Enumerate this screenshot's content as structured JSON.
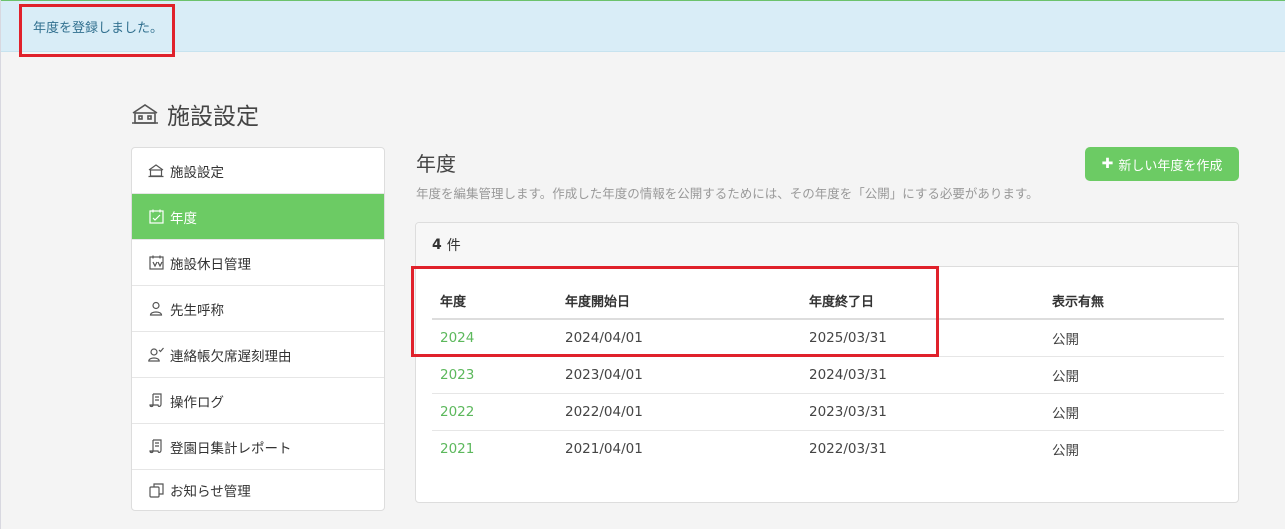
{
  "alert": {
    "message": "年度を登録しました。"
  },
  "page": {
    "title": "施設設定"
  },
  "sidebar": {
    "items": [
      {
        "label": "施設設定",
        "icon": "building-icon",
        "active": false
      },
      {
        "label": "年度",
        "icon": "calendar-icon",
        "active": true
      },
      {
        "label": "施設休日管理",
        "icon": "calendar-icon",
        "active": false
      },
      {
        "label": "先生呼称",
        "icon": "person-icon",
        "active": false
      },
      {
        "label": "連絡帳欠席遅刻理由",
        "icon": "person-check-icon",
        "active": false
      },
      {
        "label": "操作ログ",
        "icon": "scroll-icon",
        "active": false
      },
      {
        "label": "登園日集計レポート",
        "icon": "scroll-icon",
        "active": false
      },
      {
        "label": "お知らせ管理",
        "icon": "copy-icon",
        "active": false
      }
    ]
  },
  "section": {
    "title": "年度",
    "description": "年度を編集管理します。作成した年度の情報を公開するためには、その年度を「公開」にする必要があります。",
    "new_button_label": "新しい年度を作成"
  },
  "panel": {
    "count": "4",
    "count_suffix": "件"
  },
  "table": {
    "columns": [
      "年度",
      "年度開始日",
      "年度終了日",
      "表示有無"
    ],
    "rows": [
      {
        "year": "2024",
        "start": "2024/04/01",
        "end": "2025/03/31",
        "visibility": "公開"
      },
      {
        "year": "2023",
        "start": "2023/04/01",
        "end": "2024/03/31",
        "visibility": "公開"
      },
      {
        "year": "2022",
        "start": "2022/04/01",
        "end": "2023/03/31",
        "visibility": "公開"
      },
      {
        "year": "2021",
        "start": "2021/04/01",
        "end": "2022/03/31",
        "visibility": "公開"
      }
    ]
  },
  "colors": {
    "accent": "#6ccb64",
    "link": "#5cb85c",
    "alert_bg": "#d9edf7",
    "alert_text": "#31708f",
    "highlight": "#e0212b"
  }
}
